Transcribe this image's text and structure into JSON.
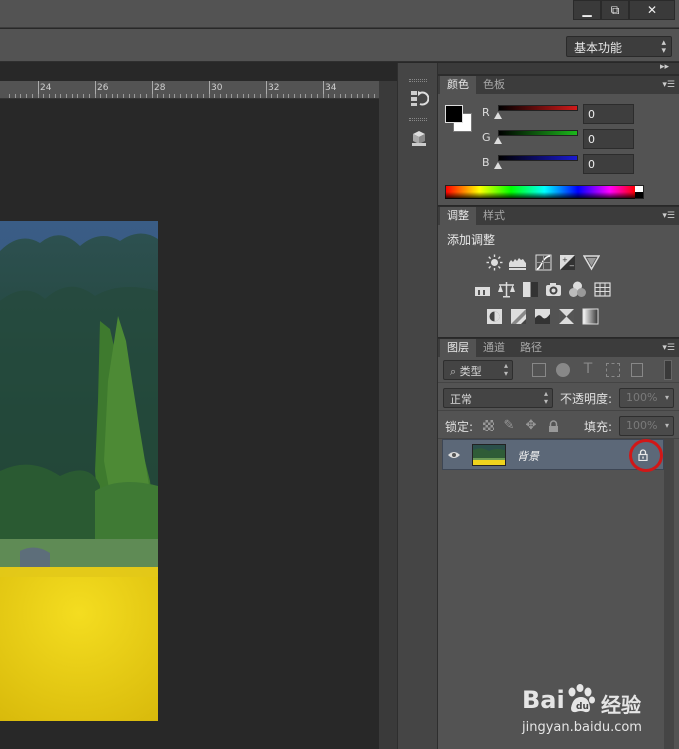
{
  "window": {
    "minimize": "▁",
    "restore": "⧉",
    "close": "✕"
  },
  "optionsbar": {
    "workspace": "基本功能"
  },
  "ruler": {
    "labels": [
      "24",
      "26",
      "28",
      "30",
      "32",
      "34"
    ]
  },
  "panel_color": {
    "tabs": [
      "颜色",
      "色板"
    ],
    "channels": [
      {
        "label": "R",
        "value": "0",
        "color": "#d11a1a"
      },
      {
        "label": "G",
        "value": "0",
        "color": "#1bb81b"
      },
      {
        "label": "B",
        "value": "0",
        "color": "#1a1ad1"
      }
    ],
    "foreground": "#000000",
    "background": "#ffffff"
  },
  "panel_adjust": {
    "tabs": [
      "调整",
      "样式"
    ],
    "title": "添加调整",
    "icons_row1": [
      "brightness-contrast-icon",
      "levels-icon",
      "curves-icon",
      "exposure-icon",
      "vibrance-icon"
    ],
    "icons_row2": [
      "hue-saturation-icon",
      "color-balance-icon",
      "black-white-icon",
      "photo-filter-icon",
      "channel-mixer-icon",
      "color-lookup-icon"
    ],
    "icons_row3": [
      "invert-icon",
      "posterize-icon",
      "threshold-icon",
      "selective-color-icon",
      "gradient-map-icon"
    ]
  },
  "panel_layers": {
    "tabs": [
      "图层",
      "通道",
      "路径"
    ],
    "filter_type": "类型",
    "blend_mode": "正常",
    "opacity_label": "不透明度:",
    "opacity_value": "100%",
    "lock_label": "锁定:",
    "fill_label": "填充:",
    "fill_value": "100%",
    "layers": [
      {
        "name": "背景",
        "visible": true,
        "locked": true
      }
    ]
  },
  "watermark": {
    "brand": "Bai",
    "brand2": "经验",
    "url": "jingyan.baidu.com"
  }
}
